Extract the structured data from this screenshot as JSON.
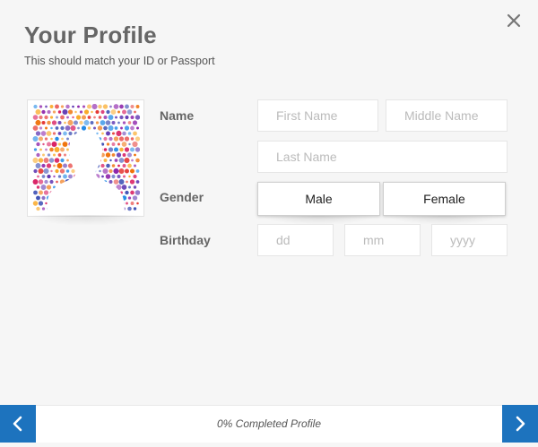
{
  "header": {
    "title": "Your Profile",
    "subtitle": "This should match your ID or Passport"
  },
  "form": {
    "name_label": "Name",
    "first_name_placeholder": "First Name",
    "middle_name_placeholder": "Middle Name",
    "last_name_placeholder": "Last Name",
    "gender_label": "Gender",
    "gender_options": [
      "Male",
      "Female"
    ],
    "birthday_label": "Birthday",
    "day_placeholder": "dd",
    "month_placeholder": "mm",
    "year_placeholder": "yyyy"
  },
  "footer": {
    "progress_text": "0% Completed Profile",
    "progress_value": 0
  },
  "icons": {
    "close": "close-icon",
    "prev": "chevron-left-icon",
    "next": "chevron-right-icon",
    "avatar": "profile-silhouette-icon"
  },
  "colors": {
    "accent": "#1d73be",
    "background": "#f6f6f6",
    "title": "#666666"
  }
}
